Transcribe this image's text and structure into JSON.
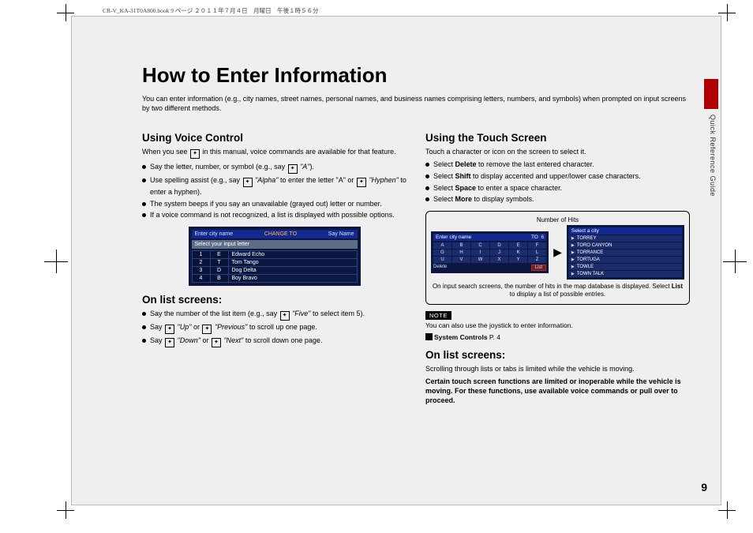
{
  "meta": {
    "book_id": "CR-V_KA-31T0A800.book  9 ページ  ２０１１年７月４日　月曜日　午後１時５６分",
    "side_label": "Quick Reference Guide",
    "page_number": "9"
  },
  "h1": "How to Enter Information",
  "intro": "You can enter information (e.g., city names, street names, personal names, and business names comprising letters, numbers, and symbols) when prompted on input screens by two different methods.",
  "voice": {
    "heading": "Using Voice Control",
    "lead_pre": "When you see ",
    "lead_post": " in this manual, voice commands are available for that feature.",
    "bullets": [
      {
        "pre": "Say the letter, number, or symbol (e.g., say ",
        "i": "\"A\"",
        "post": ")."
      },
      {
        "pre": "Use spelling assist (e.g., say ",
        "i": "\"Alpha\"",
        "mid": " to enter the letter \"A\" or ",
        "i2": "\"Hyphen\"",
        "post": " to enter a hyphen)."
      },
      {
        "pre": "The system beeps if you say an unavailable (grayed out) letter or number."
      },
      {
        "pre": "If a voice command is not recognized, a list is displayed with possible options."
      }
    ],
    "ss": {
      "title_left": "Enter city name",
      "title_mid": "CHANGE TO",
      "title_rt": "Say  Name",
      "subtitle": "Select your input letter",
      "rows": [
        {
          "n": "1",
          "l": "E",
          "t": "Edward Echo"
        },
        {
          "n": "2",
          "l": "T",
          "t": "Tom Tango"
        },
        {
          "n": "3",
          "l": "D",
          "t": "Dog Delta"
        },
        {
          "n": "4",
          "l": "B",
          "t": "Boy Bravo"
        }
      ]
    },
    "list_heading": "On list screens:",
    "list_bullets": [
      {
        "pre": "Say the number of the list item (e.g., say ",
        "i": "\"Five\"",
        "post": " to select item 5)."
      },
      {
        "pre": "Say ",
        "i": "\"Up\"",
        "mid": " or ",
        "i2": "\"Previous\"",
        "post": " to scroll up one page."
      },
      {
        "pre": "Say ",
        "i": "\"Down\"",
        "mid": " or ",
        "i2": "\"Next\"",
        "post": " to scroll down one page."
      }
    ]
  },
  "touch": {
    "heading": "Using the Touch Screen",
    "lead": "Touch a character or icon on the screen to select it.",
    "bullets": [
      {
        "pre": "Select ",
        "b": "Delete",
        "post": " to remove the last entered character."
      },
      {
        "pre": "Select ",
        "b": "Shift",
        "post": " to display accented and upper/lower case characters."
      },
      {
        "pre": "Select ",
        "b": "Space",
        "post": " to enter a space character."
      },
      {
        "pre": "Select ",
        "b": "More",
        "post": " to display symbols."
      }
    ],
    "hits_label": "Number of Hits",
    "ss_left": {
      "bar": "Enter city name",
      "bar_mid": "TO",
      "count": "6",
      "keys": [
        "A",
        "B",
        "C",
        "D",
        "E",
        "F",
        "G",
        "H",
        "I",
        "J",
        "K",
        "L",
        "U",
        "V",
        "W",
        "X",
        "Y",
        "Z"
      ],
      "bot_left": "Delete",
      "bot_right": "List"
    },
    "ss_right": {
      "bar": "Select a city",
      "items": [
        "TORREY",
        "TORO CANYON",
        "TORRANCE",
        "TORTUGA",
        "TOWLE",
        "TOWN TALK"
      ]
    },
    "caption": "On input search screens, the number of hits in the map database is displayed. Select <b>List</b> to display a list of possible entries.",
    "note_tag": "NOTE",
    "note_text": "You can also use the joystick to enter information.",
    "xref_label": "System Controls",
    "xref_page": "P. 4",
    "list_heading": "On list screens:",
    "list_lead": "Scrolling through lists or tabs is limited while the vehicle is moving.",
    "list_bold": "Certain touch screen functions are limited or inoperable while the vehicle is moving. For these functions, use available voice commands or pull over to proceed."
  }
}
